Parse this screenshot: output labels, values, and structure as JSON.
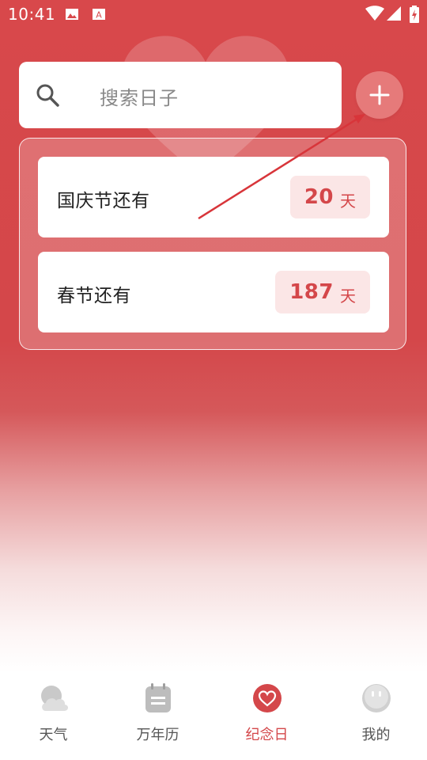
{
  "status_bar": {
    "time": "10:41",
    "icons": [
      "image-icon",
      "text-a-icon",
      "wifi-icon",
      "signal-icon",
      "signal-icon",
      "battery-charging-icon"
    ]
  },
  "search": {
    "placeholder": "搜索日子"
  },
  "add_button": {
    "icon": "plus-icon"
  },
  "events": [
    {
      "title": "国庆节还有",
      "days": "20",
      "unit": "天"
    },
    {
      "title": "春节还有",
      "days": "187",
      "unit": "天"
    }
  ],
  "bottom_nav": {
    "active_index": 2,
    "items": [
      {
        "label": "天气",
        "icon": "weather-cloud-icon"
      },
      {
        "label": "万年历",
        "icon": "calendar-icon"
      },
      {
        "label": "纪念日",
        "icon": "heart-icon"
      },
      {
        "label": "我的",
        "icon": "profile-face-icon"
      }
    ]
  },
  "colors": {
    "accent": "#d4474a",
    "badge_bg": "#fbe6e6",
    "add_button": "#e67a7a"
  }
}
